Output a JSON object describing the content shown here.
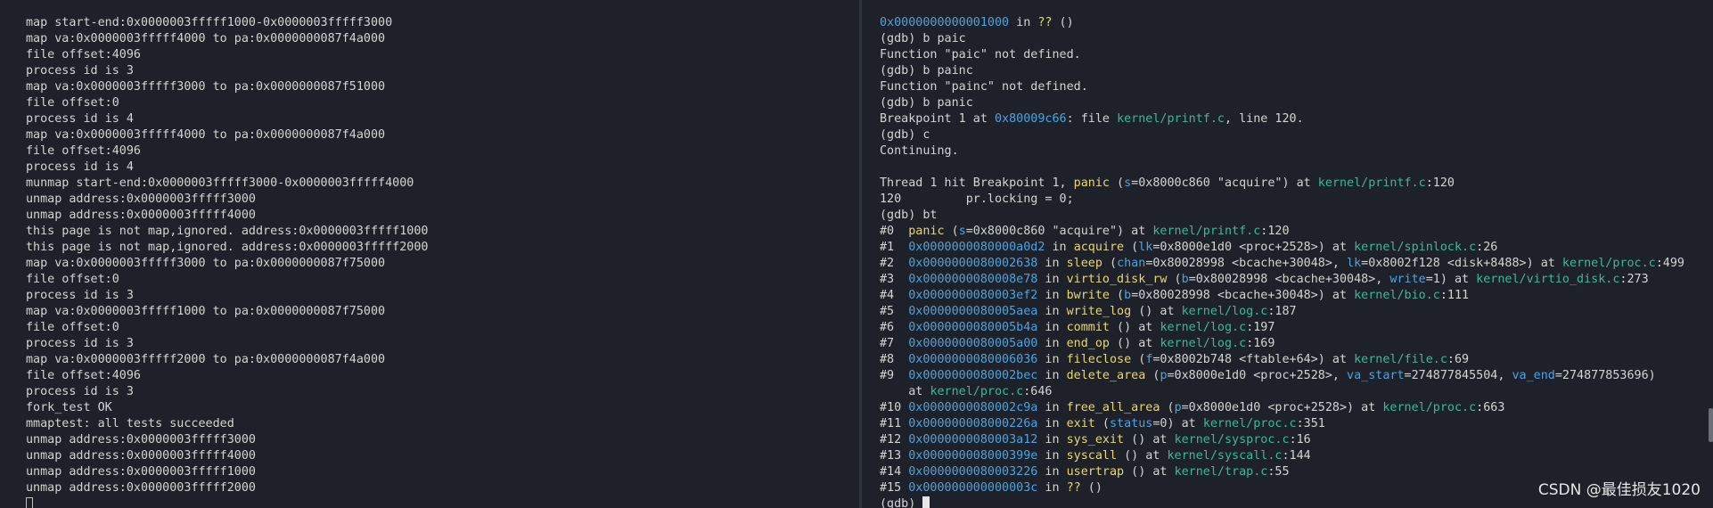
{
  "left_terminal": {
    "lines": [
      "map start-end:0x0000003fffff1000-0x0000003fffff3000",
      "map va:0x0000003fffff4000 to pa:0x0000000087f4a000",
      "file offset:4096",
      "process id is 3",
      "map va:0x0000003fffff3000 to pa:0x0000000087f51000",
      "file offset:0",
      "process id is 4",
      "map va:0x0000003fffff4000 to pa:0x0000000087f4a000",
      "file offset:4096",
      "process id is 4",
      "munmap start-end:0x0000003fffff3000-0x0000003fffff4000",
      "unmap address:0x0000003fffff3000",
      "unmap address:0x0000003fffff4000",
      "this page is not map,ignored. address:0x0000003fffff1000",
      "this page is not map,ignored. address:0x0000003fffff2000",
      "map va:0x0000003fffff3000 to pa:0x0000000087f75000",
      "file offset:0",
      "process id is 3",
      "map va:0x0000003fffff1000 to pa:0x0000000087f75000",
      "file offset:0",
      "process id is 3",
      "map va:0x0000003fffff2000 to pa:0x0000000087f4a000",
      "file offset:4096",
      "process id is 3",
      "fork_test OK",
      "mmaptest: all tests succeeded",
      "unmap address:0x0000003fffff3000",
      "unmap address:0x0000003fffff4000",
      "unmap address:0x0000003fffff1000",
      "unmap address:0x0000003fffff2000"
    ]
  },
  "right_terminal": {
    "lines": [
      [
        {
          "t": "0x0000000000001000",
          "c": "addr"
        },
        {
          "t": " in ",
          "c": "txt"
        },
        {
          "t": "??",
          "c": "q"
        },
        {
          "t": " ()",
          "c": "txt"
        }
      ],
      [
        {
          "t": "(gdb) b paic",
          "c": "txt"
        }
      ],
      [
        {
          "t": "Function \"paic\" not defined.",
          "c": "txt"
        }
      ],
      [
        {
          "t": "(gdb) b painc",
          "c": "txt"
        }
      ],
      [
        {
          "t": "Function \"painc\" not defined.",
          "c": "txt"
        }
      ],
      [
        {
          "t": "(gdb) b panic",
          "c": "txt"
        }
      ],
      [
        {
          "t": "Breakpoint 1 at ",
          "c": "txt"
        },
        {
          "t": "0x80009c66",
          "c": "addr"
        },
        {
          "t": ": file ",
          "c": "txt"
        },
        {
          "t": "kernel/printf.c",
          "c": "file"
        },
        {
          "t": ", line 120.",
          "c": "txt"
        }
      ],
      [
        {
          "t": "(gdb) c",
          "c": "txt"
        }
      ],
      [
        {
          "t": "Continuing.",
          "c": "txt"
        }
      ],
      [
        {
          "t": "",
          "c": "txt"
        }
      ],
      [
        {
          "t": "Thread 1 hit Breakpoint 1, ",
          "c": "txt"
        },
        {
          "t": "panic",
          "c": "fn"
        },
        {
          "t": " (",
          "c": "txt"
        },
        {
          "t": "s",
          "c": "arg"
        },
        {
          "t": "=0x8000c860 \"acquire\") at ",
          "c": "txt"
        },
        {
          "t": "kernel/printf.c",
          "c": "file"
        },
        {
          "t": ":120",
          "c": "txt"
        }
      ],
      [
        {
          "t": "120\t    pr.locking = 0;",
          "c": "txt"
        }
      ],
      [
        {
          "t": "(gdb) bt",
          "c": "txt"
        }
      ],
      [
        {
          "t": "#0  ",
          "c": "txt"
        },
        {
          "t": "panic",
          "c": "fn"
        },
        {
          "t": " (",
          "c": "txt"
        },
        {
          "t": "s",
          "c": "arg"
        },
        {
          "t": "=0x8000c860 \"acquire\") at ",
          "c": "txt"
        },
        {
          "t": "kernel/printf.c",
          "c": "file"
        },
        {
          "t": ":120",
          "c": "txt"
        }
      ],
      [
        {
          "t": "#1  ",
          "c": "txt"
        },
        {
          "t": "0x0000000080000a0d2",
          "c": "addr"
        },
        {
          "t": " in ",
          "c": "txt"
        },
        {
          "t": "acquire",
          "c": "fn"
        },
        {
          "t": " (",
          "c": "txt"
        },
        {
          "t": "lk",
          "c": "arg"
        },
        {
          "t": "=0x8000e1d0 <proc+2528>) at ",
          "c": "txt"
        },
        {
          "t": "kernel/spinlock.c",
          "c": "file"
        },
        {
          "t": ":26",
          "c": "txt"
        }
      ],
      [
        {
          "t": "#2  ",
          "c": "txt"
        },
        {
          "t": "0x0000000080002638",
          "c": "addr"
        },
        {
          "t": " in ",
          "c": "txt"
        },
        {
          "t": "sleep",
          "c": "fn"
        },
        {
          "t": " (",
          "c": "txt"
        },
        {
          "t": "chan",
          "c": "arg"
        },
        {
          "t": "=0x80028998 <bcache+30048>, ",
          "c": "txt"
        },
        {
          "t": "lk",
          "c": "arg"
        },
        {
          "t": "=0x8002f128 <disk+8488>) at ",
          "c": "txt"
        },
        {
          "t": "kernel/proc.c",
          "c": "file"
        },
        {
          "t": ":499",
          "c": "txt"
        }
      ],
      [
        {
          "t": "#3  ",
          "c": "txt"
        },
        {
          "t": "0x0000000080008e78",
          "c": "addr"
        },
        {
          "t": " in ",
          "c": "txt"
        },
        {
          "t": "virtio_disk_rw",
          "c": "fn"
        },
        {
          "t": " (",
          "c": "txt"
        },
        {
          "t": "b",
          "c": "arg"
        },
        {
          "t": "=0x80028998 <bcache+30048>, ",
          "c": "txt"
        },
        {
          "t": "write",
          "c": "arg"
        },
        {
          "t": "=1) at ",
          "c": "txt"
        },
        {
          "t": "kernel/virtio_disk.c",
          "c": "file"
        },
        {
          "t": ":273",
          "c": "txt"
        }
      ],
      [
        {
          "t": "#4  ",
          "c": "txt"
        },
        {
          "t": "0x0000000080003ef2",
          "c": "addr"
        },
        {
          "t": " in ",
          "c": "txt"
        },
        {
          "t": "bwrite",
          "c": "fn"
        },
        {
          "t": " (",
          "c": "txt"
        },
        {
          "t": "b",
          "c": "arg"
        },
        {
          "t": "=0x80028998 <bcache+30048>) at ",
          "c": "txt"
        },
        {
          "t": "kernel/bio.c",
          "c": "file"
        },
        {
          "t": ":111",
          "c": "txt"
        }
      ],
      [
        {
          "t": "#5  ",
          "c": "txt"
        },
        {
          "t": "0x0000000080005aea",
          "c": "addr"
        },
        {
          "t": " in ",
          "c": "txt"
        },
        {
          "t": "write_log",
          "c": "fn"
        },
        {
          "t": " () at ",
          "c": "txt"
        },
        {
          "t": "kernel/log.c",
          "c": "file"
        },
        {
          "t": ":187",
          "c": "txt"
        }
      ],
      [
        {
          "t": "#6  ",
          "c": "txt"
        },
        {
          "t": "0x0000000080005b4a",
          "c": "addr"
        },
        {
          "t": " in ",
          "c": "txt"
        },
        {
          "t": "commit",
          "c": "fn"
        },
        {
          "t": " () at ",
          "c": "txt"
        },
        {
          "t": "kernel/log.c",
          "c": "file"
        },
        {
          "t": ":197",
          "c": "txt"
        }
      ],
      [
        {
          "t": "#7  ",
          "c": "txt"
        },
        {
          "t": "0x0000000080005a00",
          "c": "addr"
        },
        {
          "t": " in ",
          "c": "txt"
        },
        {
          "t": "end_op",
          "c": "fn"
        },
        {
          "t": " () at ",
          "c": "txt"
        },
        {
          "t": "kernel/log.c",
          "c": "file"
        },
        {
          "t": ":169",
          "c": "txt"
        }
      ],
      [
        {
          "t": "#8  ",
          "c": "txt"
        },
        {
          "t": "0x0000000080006036",
          "c": "addr"
        },
        {
          "t": " in ",
          "c": "txt"
        },
        {
          "t": "fileclose",
          "c": "fn"
        },
        {
          "t": " (",
          "c": "txt"
        },
        {
          "t": "f",
          "c": "arg"
        },
        {
          "t": "=0x8002b748 <ftable+64>) at ",
          "c": "txt"
        },
        {
          "t": "kernel/file.c",
          "c": "file"
        },
        {
          "t": ":69",
          "c": "txt"
        }
      ],
      [
        {
          "t": "#9  ",
          "c": "txt"
        },
        {
          "t": "0x0000000080002bec",
          "c": "addr"
        },
        {
          "t": " in ",
          "c": "txt"
        },
        {
          "t": "delete_area",
          "c": "fn"
        },
        {
          "t": " (",
          "c": "txt"
        },
        {
          "t": "p",
          "c": "arg"
        },
        {
          "t": "=0x8000e1d0 <proc+2528>, ",
          "c": "txt"
        },
        {
          "t": "va_start",
          "c": "arg"
        },
        {
          "t": "=274877845504, ",
          "c": "txt"
        },
        {
          "t": "va_end",
          "c": "arg"
        },
        {
          "t": "=274877853696)",
          "c": "txt"
        }
      ],
      [
        {
          "t": "    at ",
          "c": "txt"
        },
        {
          "t": "kernel/proc.c",
          "c": "file"
        },
        {
          "t": ":646",
          "c": "txt"
        }
      ],
      [
        {
          "t": "#10 ",
          "c": "txt"
        },
        {
          "t": "0x0000000080002c9a",
          "c": "addr"
        },
        {
          "t": " in ",
          "c": "txt"
        },
        {
          "t": "free_all_area",
          "c": "fn"
        },
        {
          "t": " (",
          "c": "txt"
        },
        {
          "t": "p",
          "c": "arg"
        },
        {
          "t": "=0x8000e1d0 <proc+2528>) at ",
          "c": "txt"
        },
        {
          "t": "kernel/proc.c",
          "c": "file"
        },
        {
          "t": ":663",
          "c": "txt"
        }
      ],
      [
        {
          "t": "#11 ",
          "c": "txt"
        },
        {
          "t": "0x000000008000226a",
          "c": "addr"
        },
        {
          "t": " in ",
          "c": "txt"
        },
        {
          "t": "exit",
          "c": "fn"
        },
        {
          "t": " (",
          "c": "txt"
        },
        {
          "t": "status",
          "c": "arg"
        },
        {
          "t": "=0) at ",
          "c": "txt"
        },
        {
          "t": "kernel/proc.c",
          "c": "file"
        },
        {
          "t": ":351",
          "c": "txt"
        }
      ],
      [
        {
          "t": "#12 ",
          "c": "txt"
        },
        {
          "t": "0x0000000080003a12",
          "c": "addr"
        },
        {
          "t": " in ",
          "c": "txt"
        },
        {
          "t": "sys_exit",
          "c": "fn"
        },
        {
          "t": " () at ",
          "c": "txt"
        },
        {
          "t": "kernel/sysproc.c",
          "c": "file"
        },
        {
          "t": ":16",
          "c": "txt"
        }
      ],
      [
        {
          "t": "#13 ",
          "c": "txt"
        },
        {
          "t": "0x000000008000399e",
          "c": "addr"
        },
        {
          "t": " in ",
          "c": "txt"
        },
        {
          "t": "syscall",
          "c": "fn"
        },
        {
          "t": " () at ",
          "c": "txt"
        },
        {
          "t": "kernel/syscall.c",
          "c": "file"
        },
        {
          "t": ":144",
          "c": "txt"
        }
      ],
      [
        {
          "t": "#14 ",
          "c": "txt"
        },
        {
          "t": "0x0000000080003226",
          "c": "addr"
        },
        {
          "t": " in ",
          "c": "txt"
        },
        {
          "t": "usertrap",
          "c": "fn"
        },
        {
          "t": " () at ",
          "c": "txt"
        },
        {
          "t": "kernel/trap.c",
          "c": "file"
        },
        {
          "t": ":55",
          "c": "txt"
        }
      ],
      [
        {
          "t": "#15 ",
          "c": "txt"
        },
        {
          "t": "0x000000000000003c",
          "c": "addr"
        },
        {
          "t": " in ",
          "c": "txt"
        },
        {
          "t": "??",
          "c": "q"
        },
        {
          "t": " ()",
          "c": "txt"
        }
      ]
    ],
    "prompt": "(gdb) "
  },
  "watermark": "CSDN @最佳损友1020"
}
